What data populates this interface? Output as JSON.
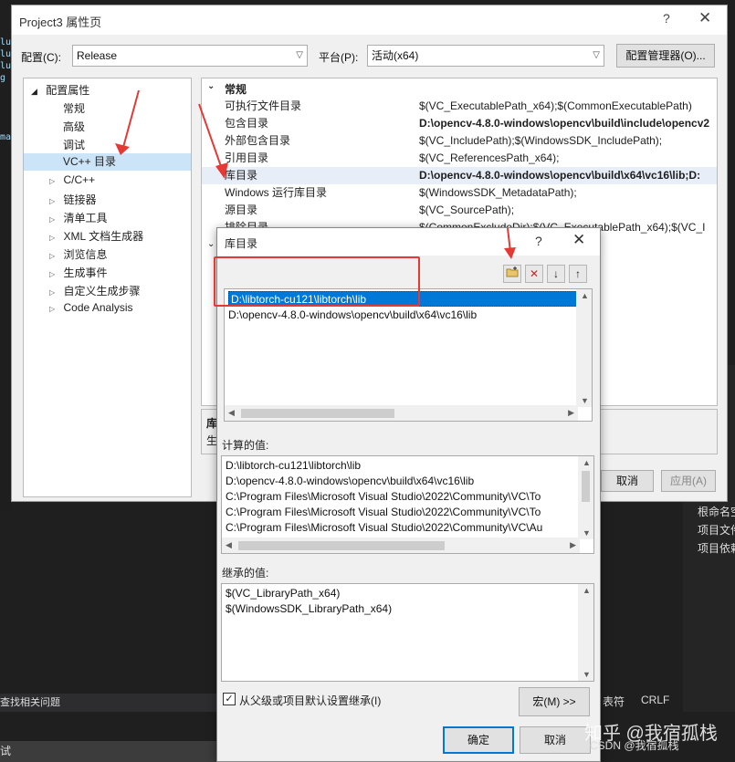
{
  "window": {
    "title": "Project3 属性页",
    "help": "?",
    "close": "✕"
  },
  "config_row": {
    "config_label": "配置(C):",
    "config_value": "Release",
    "platform_label": "平台(P):",
    "platform_value": "活动(x64)",
    "manager_button": "配置管理器(O)..."
  },
  "tree": {
    "root": "配置属性",
    "items": [
      "常规",
      "高级",
      "调试",
      "VC++ 目录"
    ],
    "collapsed": [
      "C/C++",
      "链接器",
      "清单工具",
      "XML 文档生成器",
      "浏览信息",
      "生成事件",
      "自定义生成步骤",
      "Code Analysis"
    ]
  },
  "grid": {
    "section": "常规",
    "rows": [
      {
        "key": "可执行文件目录",
        "value": "$(VC_ExecutablePath_x64);$(CommonExecutablePath)",
        "bold": false
      },
      {
        "key": "包含目录",
        "value": "D:\\opencv-4.8.0-windows\\opencv\\build\\include\\opencv2",
        "bold": true
      },
      {
        "key": "外部包含目录",
        "value": "$(VC_IncludePath);$(WindowsSDK_IncludePath);",
        "bold": false
      },
      {
        "key": "引用目录",
        "value": "$(VC_ReferencesPath_x64);",
        "bold": false
      },
      {
        "key": "库目录",
        "value": "D:\\opencv-4.8.0-windows\\opencv\\build\\x64\\vc16\\lib;D:",
        "bold": true
      },
      {
        "key": "Windows 运行库目录",
        "value": "$(WindowsSDK_MetadataPath);",
        "bold": false
      },
      {
        "key": "源目录",
        "value": "$(VC_SourcePath);",
        "bold": false
      },
      {
        "key": "排除目录",
        "value": "$(CommonExcludeDir);$(VC_ExecutablePath_x64);$(VC_I",
        "bold": false
      }
    ],
    "desc_title": "库",
    "desc_text": "生"
  },
  "footer_buttons": {
    "cancel": "取消",
    "apply": "应用(A)"
  },
  "dialog": {
    "title": "库目录",
    "help": "?",
    "close": "✕",
    "toolbar": {
      "new_folder": "new-folder-icon",
      "delete": "✕",
      "down": "↓",
      "up": "↑"
    },
    "entries": [
      "D:\\libtorch-cu121\\libtorch\\lib",
      "D:\\opencv-4.8.0-windows\\opencv\\build\\x64\\vc16\\lib"
    ],
    "computed_label": "计算的值:",
    "computed": [
      "D:\\libtorch-cu121\\libtorch\\lib",
      "D:\\opencv-4.8.0-windows\\opencv\\build\\x64\\vc16\\lib",
      "C:\\Program Files\\Microsoft Visual Studio\\2022\\Community\\VC\\To",
      "C:\\Program Files\\Microsoft Visual Studio\\2022\\Community\\VC\\To",
      "C:\\Program Files\\Microsoft Visual Studio\\2022\\Community\\VC\\Au"
    ],
    "inherited_label": "继承的值:",
    "inherited": [
      "$(VC_LibraryPath_x64)",
      "$(WindowsSDK_LibraryPath_x64)"
    ],
    "inherit_checkbox": "从父级或项目默认设置继承(I)",
    "macro_button": "宏(M) >>",
    "ok_button": "确定",
    "cancel_button": "取消"
  },
  "vs_bg": {
    "right_items": [
      "根命名空",
      "项目文件",
      "项目依赖"
    ],
    "bottom_left": "查找相关问题",
    "status_left": "试",
    "status_right_a": "表符",
    "status_right_b": "CRLF"
  },
  "watermark": {
    "main": "知乎 @我宿孤栈",
    "sub": "CSDN @我宿孤栈"
  }
}
